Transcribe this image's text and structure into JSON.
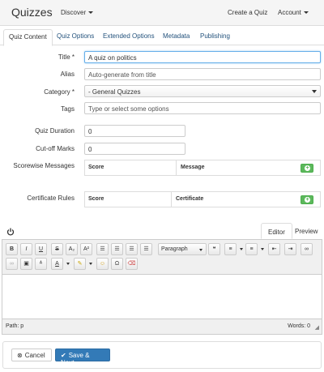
{
  "navbar": {
    "brand": "Quizzes",
    "discover": "Discover",
    "create_quiz": "Create a Quiz",
    "account": "Account"
  },
  "tabs": [
    {
      "label": "Quiz Content"
    },
    {
      "label": "Quiz Options"
    },
    {
      "label": "Extended Options"
    },
    {
      "label": "Metadata"
    },
    {
      "label": "Publishing"
    }
  ],
  "form": {
    "title_label": "Title *",
    "title_value": "A quiz on politics",
    "alias_label": "Alias",
    "alias_placeholder": "Auto-generate from title",
    "category_label": "Category *",
    "category_value": "- General Quizzes",
    "tags_label": "Tags",
    "tags_placeholder": "Type or select some options",
    "duration_label": "Quiz Duration",
    "duration_value": "0",
    "cutoff_label": "Cut-off Marks",
    "cutoff_value": "0",
    "scorewise_label": "Scorewise Messages",
    "scorewise_score_col": "Score",
    "scorewise_message_col": "Message",
    "cert_label": "Certificate Rules",
    "cert_score_col": "Score",
    "cert_cert_col": "Certificate"
  },
  "editor": {
    "tab_editor": "Editor",
    "tab_preview": "Preview",
    "format_select": "Paragraph",
    "path_label": "Path: p",
    "word_count": "Words: 0",
    "toolbar_row1": [
      "B",
      "I",
      "U",
      "S",
      "A₂",
      "A²"
    ],
    "icons": [
      "power-icon",
      "bold-icon",
      "italic-icon",
      "underline-icon",
      "strikethrough-icon",
      "subscript-icon",
      "superscript-icon",
      "align-left-icon",
      "align-center-icon",
      "align-right-icon",
      "align-justify-icon",
      "numbered-list-icon",
      "bulleted-list-icon",
      "outdent-icon",
      "indent-icon",
      "link-icon",
      "unlink-icon",
      "image-icon",
      "spellcheck-icon",
      "text-color-icon",
      "highlight-icon",
      "emoji-icon",
      "special-char-icon",
      "eraser-icon"
    ]
  },
  "footer": {
    "cancel_label": "Cancel",
    "save_label": "Save & Next"
  },
  "colors": {
    "primary": "#337ab7",
    "success": "#5cb85c",
    "link": "#23527c"
  }
}
